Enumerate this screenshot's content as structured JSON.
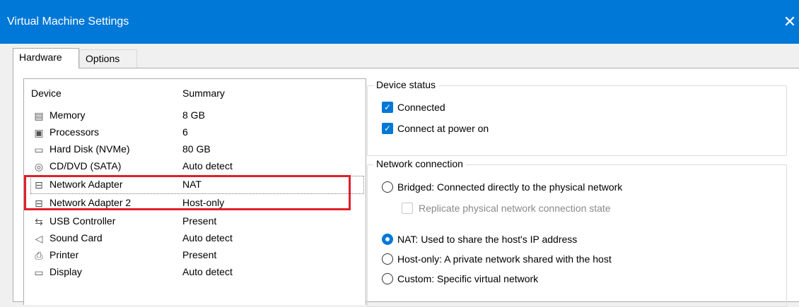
{
  "window": {
    "title": "Virtual Machine Settings",
    "close_glyph": "✕"
  },
  "tabs": [
    {
      "label": "Hardware"
    },
    {
      "label": "Options"
    }
  ],
  "device_list": {
    "headers": {
      "device": "Device",
      "summary": "Summary"
    },
    "rows": [
      {
        "name": "Memory",
        "summary": "8 GB",
        "icon": "memory-icon",
        "glyph": "▤"
      },
      {
        "name": "Processors",
        "summary": "6",
        "icon": "processor-icon",
        "glyph": "▣"
      },
      {
        "name": "Hard Disk (NVMe)",
        "summary": "80 GB",
        "icon": "hard-disk-icon",
        "glyph": "▭"
      },
      {
        "name": "CD/DVD (SATA)",
        "summary": "Auto detect",
        "icon": "cd-dvd-icon",
        "glyph": "◎"
      },
      {
        "name": "Network Adapter",
        "summary": "NAT",
        "icon": "network-adapter-icon",
        "glyph": "⊟"
      },
      {
        "name": "Network Adapter 2",
        "summary": "Host-only",
        "icon": "network-adapter-icon",
        "glyph": "⊟"
      },
      {
        "name": "USB Controller",
        "summary": "Present",
        "icon": "usb-icon",
        "glyph": "⇆"
      },
      {
        "name": "Sound Card",
        "summary": "Auto detect",
        "icon": "speaker-icon",
        "glyph": "◁"
      },
      {
        "name": "Printer",
        "summary": "Present",
        "icon": "printer-icon",
        "glyph": "⎙"
      },
      {
        "name": "Display",
        "summary": "Auto detect",
        "icon": "display-icon",
        "glyph": "▭"
      }
    ]
  },
  "device_status": {
    "legend": "Device status",
    "connected": {
      "label": "Connected",
      "checked": true
    },
    "connect_at_power_on": {
      "label": "Connect at power on",
      "checked": true
    }
  },
  "network_connection": {
    "legend": "Network connection",
    "bridged": {
      "label": "Bridged: Connected directly to the physical network",
      "selected": false
    },
    "replicate": {
      "label": "Replicate physical network connection state",
      "checked": false,
      "disabled": true
    },
    "nat": {
      "label": "NAT: Used to share the host's IP address",
      "selected": true
    },
    "host_only": {
      "label": "Host-only: A private network shared with the host",
      "selected": false
    },
    "custom": {
      "label": "Custom: Specific virtual network",
      "selected": false
    }
  },
  "colors": {
    "accent": "#0078d7",
    "highlight": "#e0202a"
  }
}
